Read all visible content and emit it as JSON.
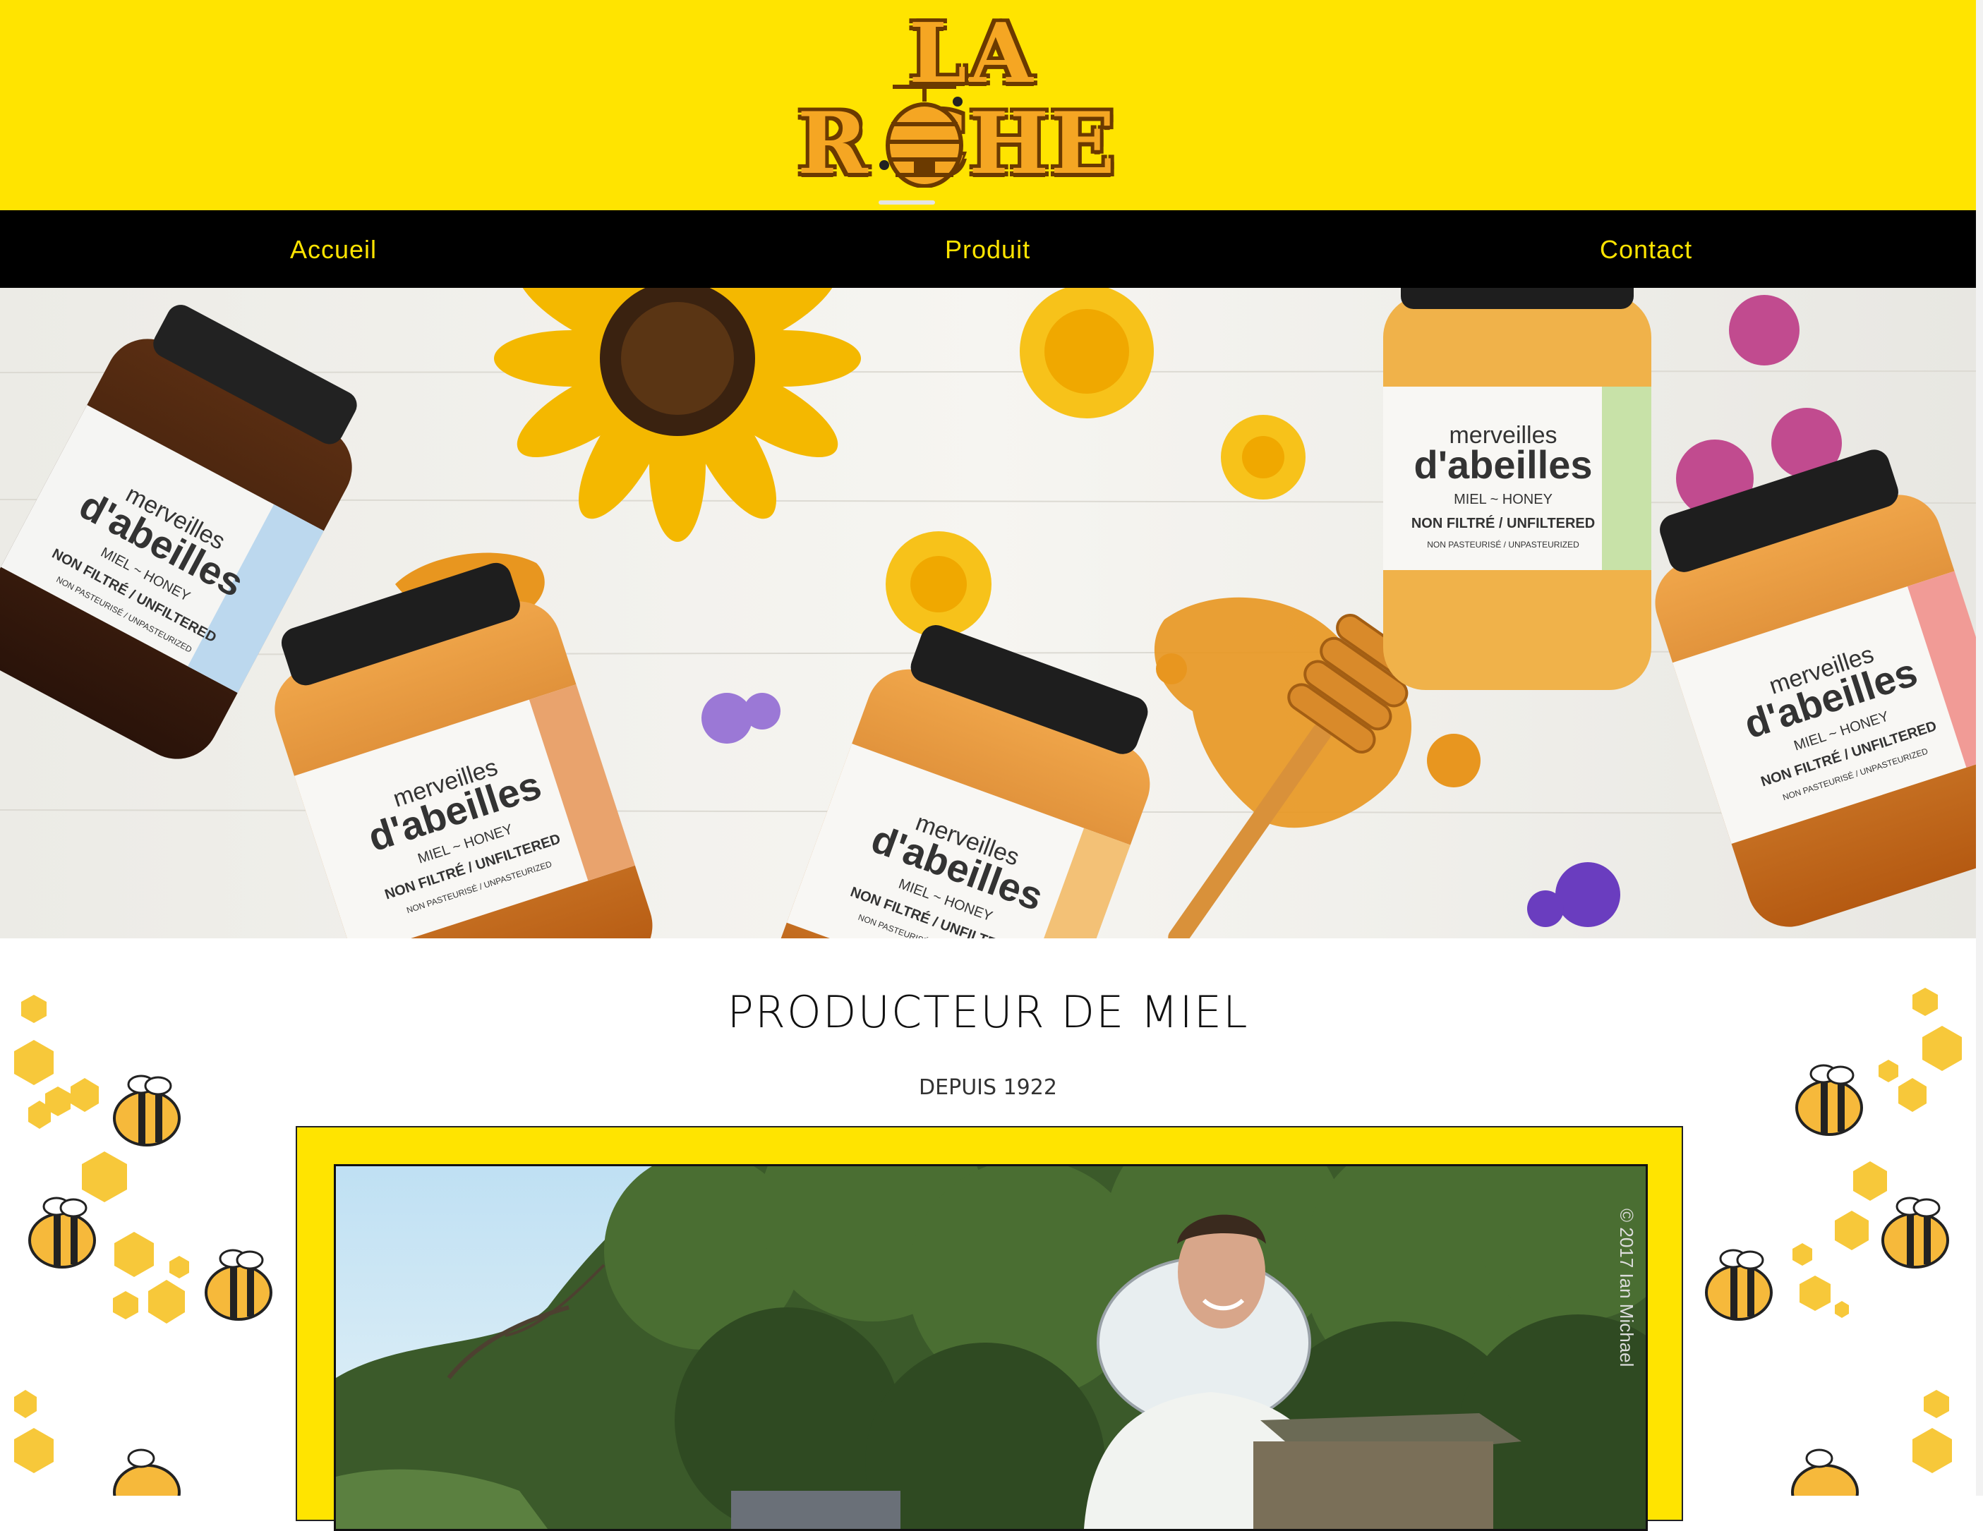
{
  "brand": {
    "logo_line1": "LA",
    "logo_line2": "R   CHE"
  },
  "nav": {
    "items": [
      {
        "label": "Accueil"
      },
      {
        "label": "Produit"
      },
      {
        "label": "Contact"
      }
    ]
  },
  "hero": {
    "jars": [
      {
        "line1": "merveilles",
        "line2": "d'abeilles",
        "line3": "MIEL ~ HONEY",
        "line4": "NON FILTRÉ / UNFILTERED",
        "line5": "NON PASTEURISÉ / UNPASTEURIZED"
      }
    ]
  },
  "main": {
    "headline": "PRODUCTEUR DE MIEL",
    "subhead": "DEPUIS 1922",
    "photo_watermark": "© 2017 Ian Michael"
  },
  "colors": {
    "brand_yellow": "#FFE400",
    "nav_background": "#000000",
    "honey": "#F5A623"
  }
}
